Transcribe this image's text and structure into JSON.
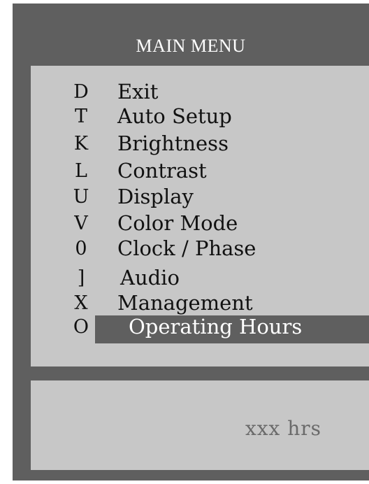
{
  "osd": {
    "title": "MAIN MENU",
    "items": [
      {
        "icon_glyph": "D",
        "label": "Exit",
        "selected": false
      },
      {
        "icon_glyph": "T",
        "label": "Auto Setup",
        "selected": false
      },
      {
        "icon_glyph": "K",
        "label": "Brightness",
        "selected": false
      },
      {
        "icon_glyph": "L",
        "label": "Contrast",
        "selected": false
      },
      {
        "icon_glyph": "U",
        "label": "Display",
        "selected": false
      },
      {
        "icon_glyph": "V",
        "label": "Color Mode",
        "selected": false
      },
      {
        "icon_glyph": "0",
        "label": "Clock / Phase",
        "selected": false
      },
      {
        "icon_glyph": "]",
        "label": "Audio",
        "selected": false
      },
      {
        "icon_glyph": "X",
        "label": "Management",
        "selected": false
      },
      {
        "icon_glyph": "O",
        "label": "Operating Hours",
        "selected": true
      }
    ],
    "info_value": "xxx hrs"
  },
  "colors": {
    "frame": "#5f5f5f",
    "panel": "#c7c7c7",
    "highlight": "#5f5f5f",
    "title_text": "#ffffff",
    "item_text": "#111111",
    "info_text": "#6a6a6a"
  }
}
